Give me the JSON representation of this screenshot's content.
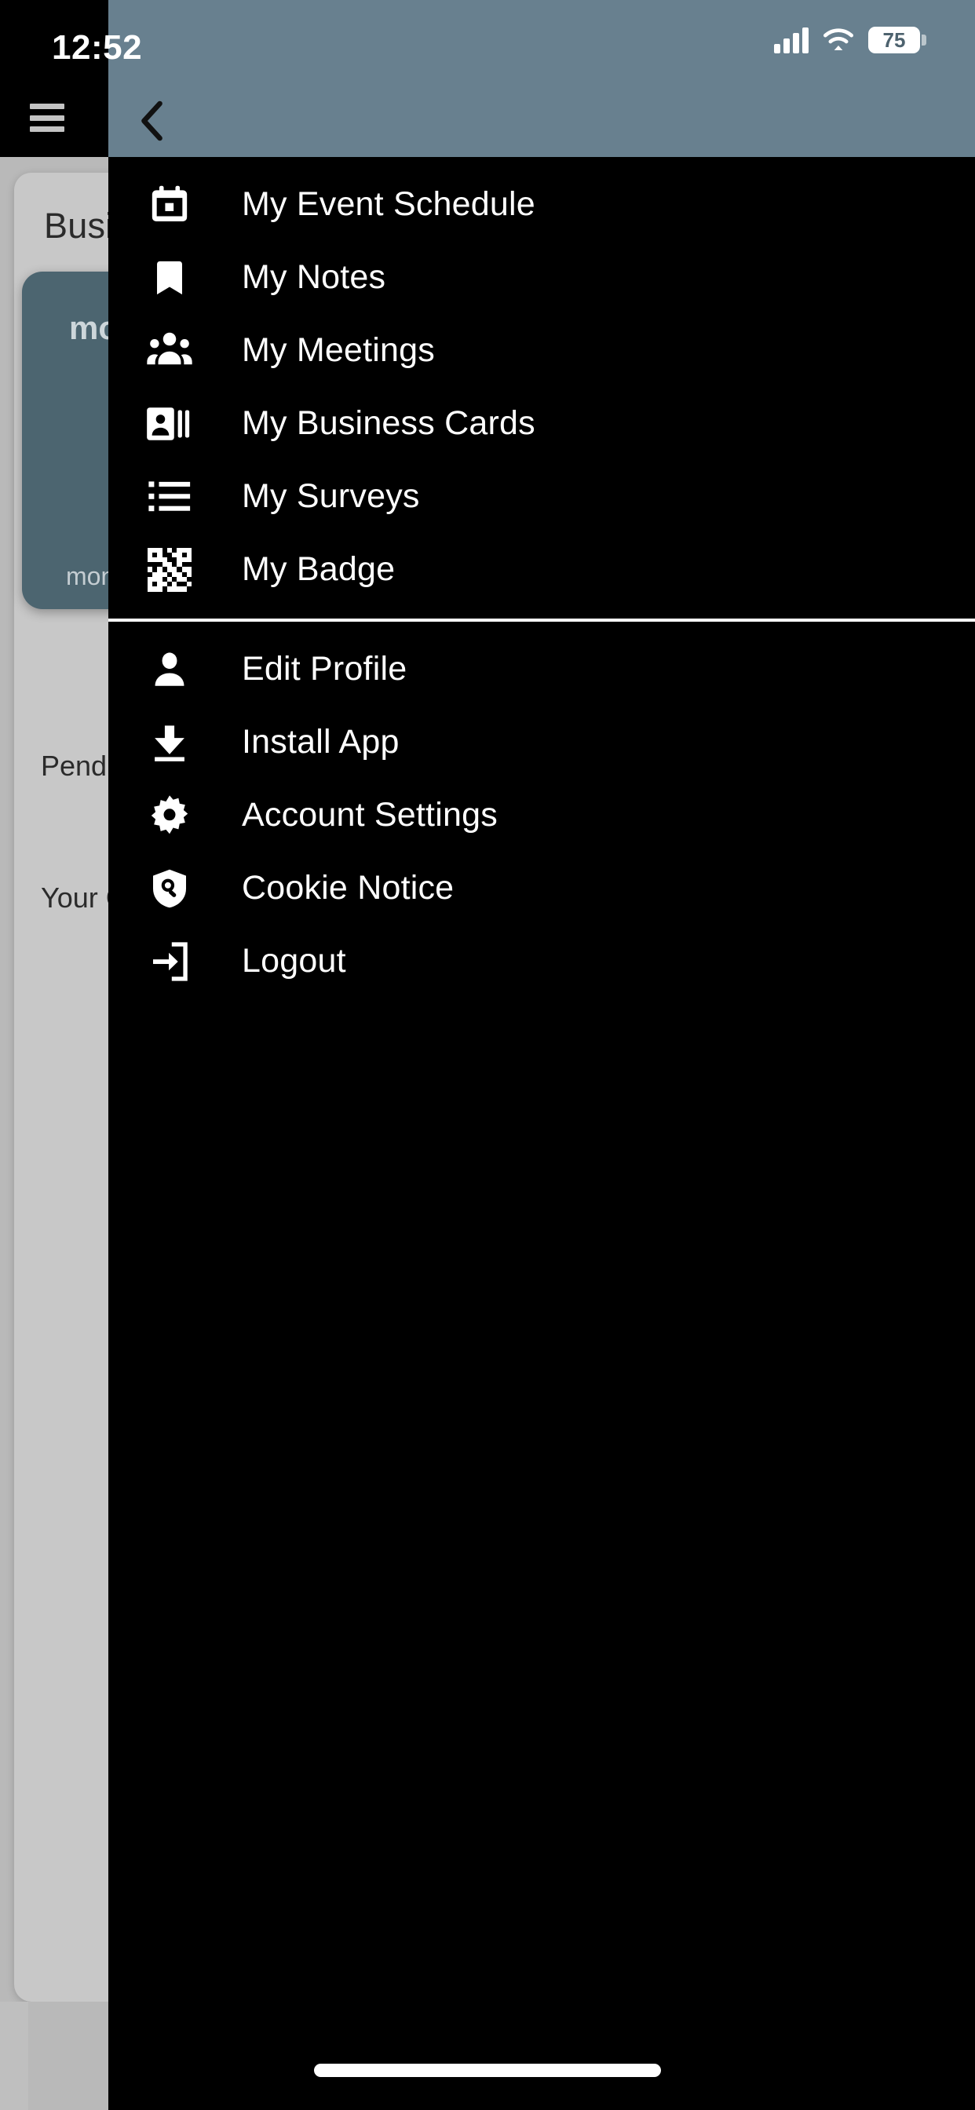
{
  "status_bar": {
    "time": "12:52",
    "battery_percent": "75",
    "signal_icon": "cellular-signal-icon",
    "wifi_icon": "wifi-icon",
    "battery_icon": "battery-icon"
  },
  "header": {
    "menu_icon": "hamburger-menu-icon",
    "back_icon": "chevron-left-icon",
    "accent_color": "#68808f"
  },
  "background_page": {
    "title": "Busin",
    "hero_title": "mor",
    "hero_subtitle": "monit",
    "paragraph_1": "Pendin",
    "paragraph_2": "Your\nContac",
    "card_color": "#c8c8c8",
    "hero_color": "#4c6570"
  },
  "drawer": {
    "background_color": "#000000",
    "text_color": "#ffffff",
    "sections": [
      {
        "id": "primary",
        "items": [
          {
            "label": "My Event Schedule",
            "icon": "calendar-icon"
          },
          {
            "label": "My Notes",
            "icon": "bookmark-icon"
          },
          {
            "label": "My Meetings",
            "icon": "people-group-icon"
          },
          {
            "label": "My Business Cards",
            "icon": "contact-card-icon"
          },
          {
            "label": "My Surveys",
            "icon": "list-icon"
          },
          {
            "label": "My Badge",
            "icon": "qr-code-icon"
          }
        ]
      },
      {
        "id": "secondary",
        "items": [
          {
            "label": "Edit Profile",
            "icon": "person-icon"
          },
          {
            "label": "Install App",
            "icon": "download-icon"
          },
          {
            "label": "Account Settings",
            "icon": "gear-icon"
          },
          {
            "label": "Cookie Notice",
            "icon": "shield-privacy-icon"
          },
          {
            "label": "Logout",
            "icon": "logout-arrow-icon"
          }
        ]
      }
    ]
  },
  "home_indicator": {
    "label": "home-indicator"
  }
}
